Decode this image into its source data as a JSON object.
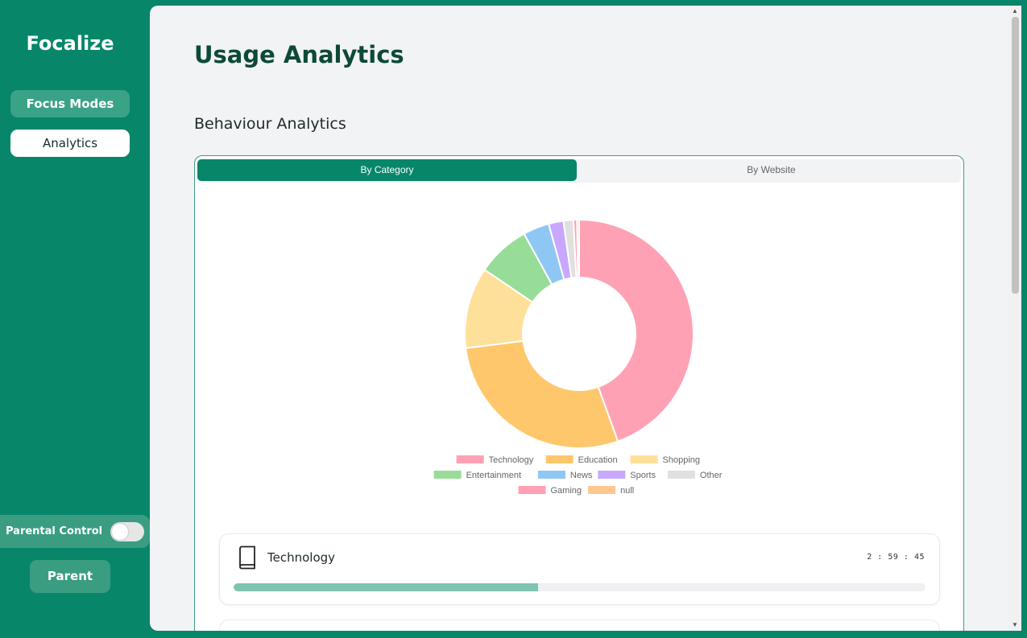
{
  "app": {
    "brand": "Focalize"
  },
  "sidebar": {
    "items": [
      {
        "label": "Focus Modes"
      },
      {
        "label": "Analytics"
      }
    ],
    "parental_control_label": "Parental Control",
    "parental_control_on": false,
    "parent_button": "Parent"
  },
  "main": {
    "title": "Usage Analytics",
    "section_title": "Behaviour Analytics",
    "tabs": [
      {
        "label": "By Category",
        "active": true
      },
      {
        "label": "By Website",
        "active": false
      }
    ]
  },
  "chart_data": {
    "type": "pie",
    "variant": "doughnut",
    "categories": [
      "Technology",
      "Education",
      "Shopping",
      "Entertainment",
      "News",
      "Sports",
      "Other",
      "Gaming",
      "null"
    ],
    "values": [
      44.5,
      28.5,
      11.5,
      7.5,
      3.7,
      2.1,
      1.4,
      0.5,
      0.3
    ],
    "colors": [
      "#ffa1b5",
      "#ffc76b",
      "#ffe09a",
      "#97dc97",
      "#8ec7f3",
      "#c8a8ff",
      "#e0e0e0",
      "#ffa1b5",
      "#ffc68f"
    ],
    "legend": "bottom"
  },
  "category_list": [
    {
      "name": "Technology",
      "icon": "book-icon",
      "time": "2 : 59 : 45",
      "progress": 0.44
    }
  ],
  "colors": {
    "accent": "#07866a",
    "title": "#0c4a38",
    "progress": "#7fc3b0"
  }
}
